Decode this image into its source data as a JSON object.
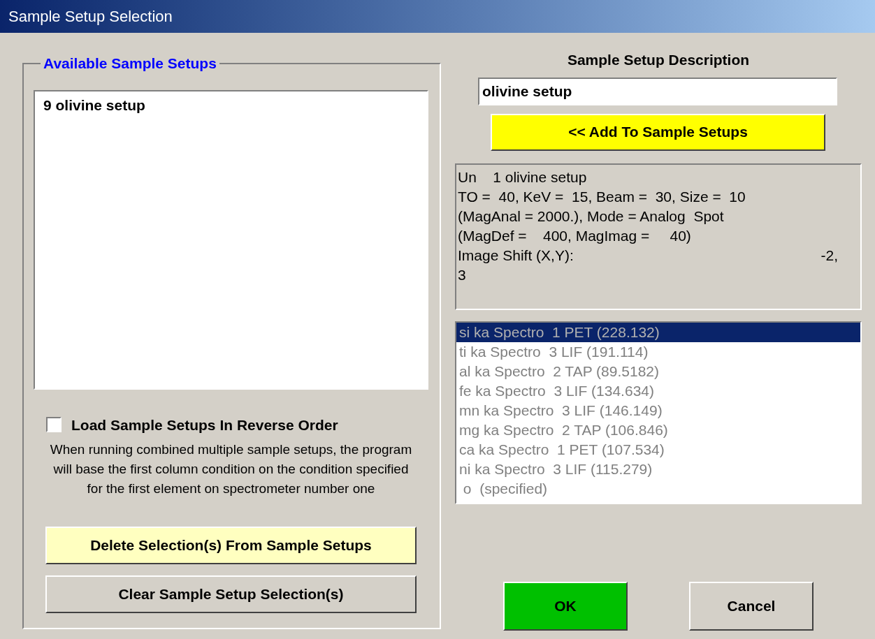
{
  "window": {
    "title": "Sample Setup Selection"
  },
  "available": {
    "legend": "Available Sample Setups",
    "items": [
      {
        "label": "9 olivine setup",
        "selected": false
      }
    ]
  },
  "reverse_order": {
    "label": "Load Sample Setups In Reverse Order",
    "checked": false,
    "note": "When running combined multiple sample setups, the program will base the first column condition on the condition specified for the first element on spectrometer number one"
  },
  "delete_button": "Delete Selection(s) From Sample Setups",
  "clear_button": "Clear Sample Setup Selection(s)",
  "description": {
    "label": "Sample Setup Description",
    "value": "olivine setup"
  },
  "add_button": "<< Add To Sample Setups",
  "info_lines": [
    {
      "text": "Un    1 olivine setup"
    },
    {
      "text": "TO =  40, KeV =  15, Beam =  30, Size =  10"
    },
    {
      "text": "(MagAnal = 2000.), Mode = Analog  Spot"
    },
    {
      "text": "(MagDef =    400, MagImag =     40)"
    },
    {
      "text": "Image Shift (X,Y):",
      "value": "-2,"
    },
    {
      "text": "3"
    }
  ],
  "elements": [
    {
      "label": "si ka Spectro  1 PET (228.132)",
      "selected": true
    },
    {
      "label": "ti ka Spectro  3 LIF (191.114)",
      "selected": false
    },
    {
      "label": "al ka Spectro  2 TAP (89.5182)",
      "selected": false
    },
    {
      "label": "fe ka Spectro  3 LIF (134.634)",
      "selected": false
    },
    {
      "label": "mn ka Spectro  3 LIF (146.149)",
      "selected": false
    },
    {
      "label": "mg ka Spectro  2 TAP (106.846)",
      "selected": false
    },
    {
      "label": "ca ka Spectro  1 PET (107.534)",
      "selected": false
    },
    {
      "label": "ni ka Spectro  3 LIF (115.279)",
      "selected": false
    },
    {
      "label": " o  (specified)",
      "selected": false
    }
  ],
  "ok_button": "OK",
  "cancel_button": "Cancel"
}
